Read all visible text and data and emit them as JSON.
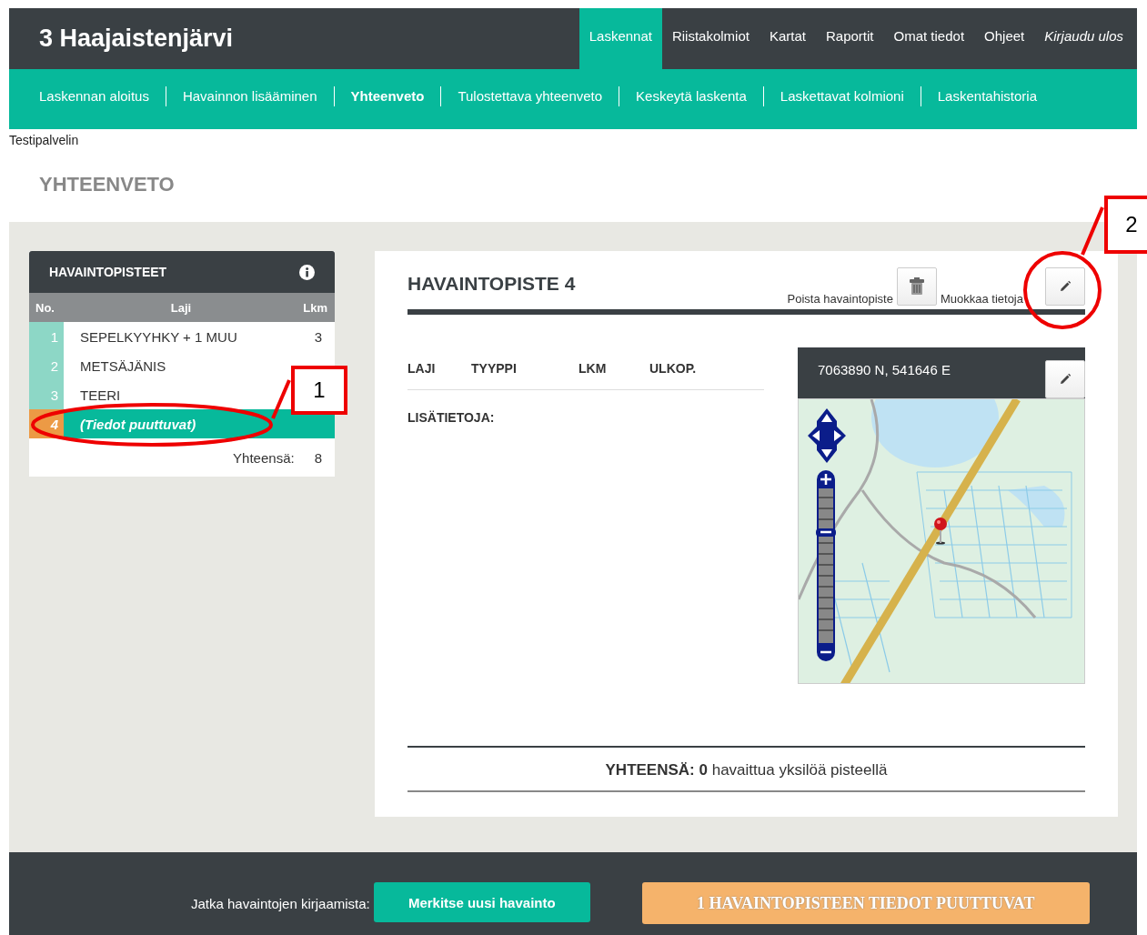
{
  "header": {
    "title": "3 Haajaistenjärvi",
    "nav": [
      {
        "label": "Laskennat",
        "selected": true,
        "kind": "link"
      },
      {
        "label": "Riistakolmiot",
        "selected": false,
        "kind": "link"
      },
      {
        "label": "Kartat",
        "selected": false,
        "kind": "link"
      },
      {
        "label": "Raportit",
        "selected": false,
        "kind": "link"
      },
      {
        "label": "Omat tiedot",
        "selected": false,
        "kind": "link"
      },
      {
        "label": "Ohjeet",
        "selected": false,
        "kind": "link"
      },
      {
        "label": "Kirjaudu ulos",
        "selected": false,
        "kind": "logout"
      }
    ]
  },
  "subnav": [
    {
      "label": "Laskennan aloitus",
      "selected": false
    },
    {
      "label": "Havainnon lisääminen",
      "selected": false
    },
    {
      "label": "Yhteenveto",
      "selected": true
    },
    {
      "label": "Tulostettava yhteenveto",
      "selected": false
    },
    {
      "label": "Keskeytä laskenta",
      "selected": false
    },
    {
      "label": "Laskettavat kolmioni",
      "selected": false
    },
    {
      "label": "Laskentahistoria",
      "selected": false
    }
  ],
  "environment": "Testipalvelin",
  "page_title": "YHTEENVETO",
  "points_panel": {
    "title": "HAVAINTOPISTEET",
    "columns": [
      "No.",
      "Laji",
      "Lkm"
    ],
    "rows": [
      {
        "no": "1",
        "species": "SEPELKYYHKY + 1 MUU",
        "count": "3",
        "selected": false,
        "incomplete": false
      },
      {
        "no": "2",
        "species": "METSÄJÄNIS",
        "selected": false,
        "incomplete": false
      },
      {
        "no": "3",
        "species": "TEERI",
        "selected": false,
        "incomplete": false
      },
      {
        "no": "4",
        "species": "(Tiedot puuttuvat)",
        "selected": true,
        "incomplete": true
      }
    ],
    "total_label": "Yhteensä:",
    "total": "8"
  },
  "detail": {
    "title": "HAVAINTOPISTE 4",
    "delete_label": "Poista havaintopiste",
    "edit_label": "Muokkaa tietoja",
    "columns": [
      "LAJI",
      "TYYPPI",
      "LKM",
      "ULKOP."
    ],
    "extra_label": "LISÄTIETOJA:",
    "map": {
      "coordinates": "7063890 N, 541646 E",
      "kind": "picture"
    },
    "total": "**YHTEENSÄ: 0** havaittua yksilöä pisteellä"
  },
  "footer": {
    "label": "Jatka havaintojen kirjaamista:",
    "new_button": "Merkitse uusi havainto",
    "status_button": "1 HAVAINTOPISTEEN TIEDOT PUUTTUVAT"
  },
  "annotations": [
    {
      "label": "1"
    },
    {
      "label": "2"
    }
  ]
}
